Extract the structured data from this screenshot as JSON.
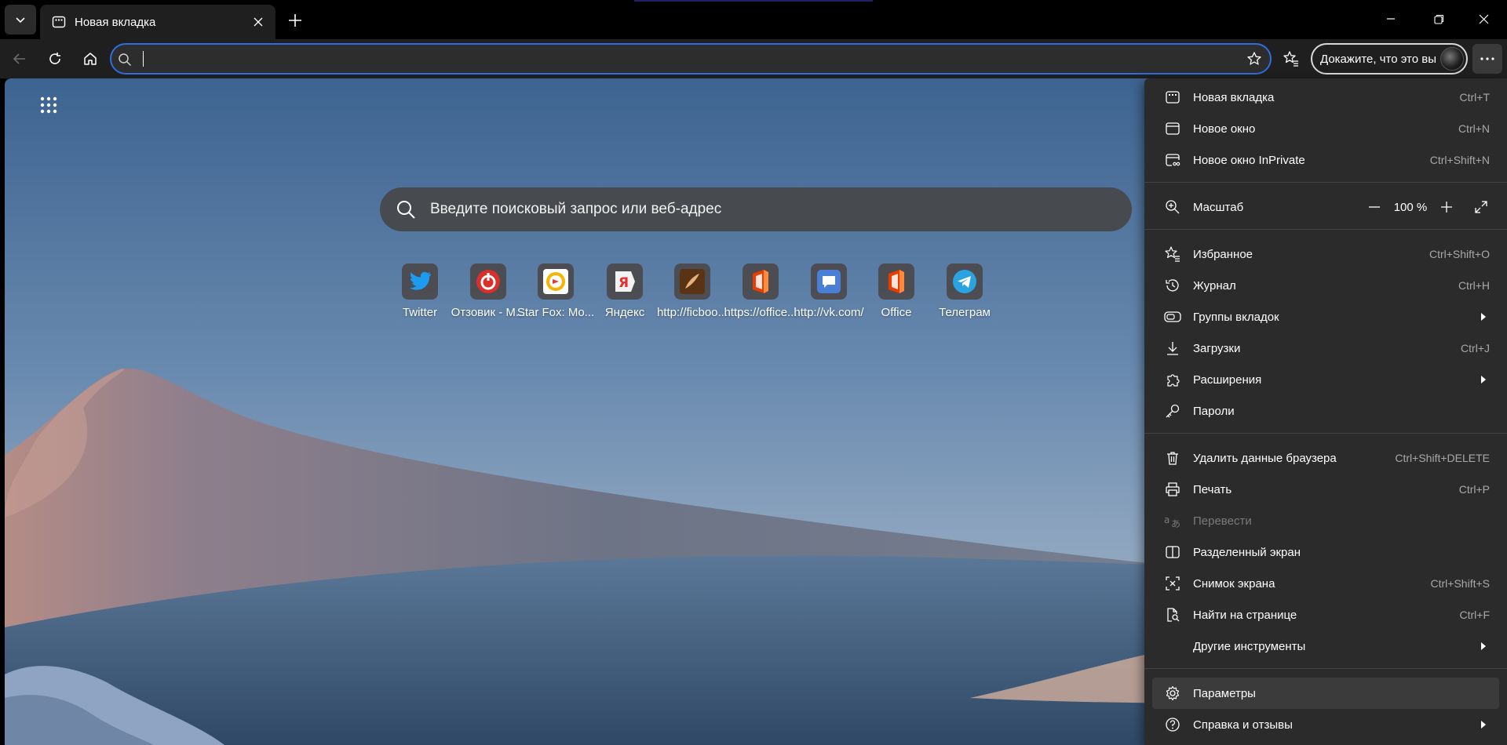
{
  "tab": {
    "title": "Новая вкладка"
  },
  "address": {
    "value": ""
  },
  "profile": {
    "label": "Докажите, что это вы"
  },
  "ntp": {
    "search_placeholder": "Введите поисковый запрос или веб-адрес",
    "tiles": [
      {
        "label": "Twitter",
        "icon": "twitter-icon"
      },
      {
        "label": "Отзовик - М...",
        "icon": "otzovik-icon"
      },
      {
        "label": "Star Fox: Mo...",
        "icon": "starfox-icon"
      },
      {
        "label": "Яндекс",
        "icon": "yandex-icon"
      },
      {
        "label": "http://ficboo...",
        "icon": "ficbook-icon"
      },
      {
        "label": "https://office...",
        "icon": "office-icon"
      },
      {
        "label": "http://vk.com/",
        "icon": "chat-bubble-icon"
      },
      {
        "label": "Office",
        "icon": "office-icon"
      },
      {
        "label": "Телеграм",
        "icon": "telegram-icon"
      }
    ]
  },
  "menu": {
    "new_tab": {
      "label": "Новая вкладка",
      "shortcut": "Ctrl+T"
    },
    "new_window": {
      "label": "Новое окно",
      "shortcut": "Ctrl+N"
    },
    "inprivate": {
      "label": "Новое окно InPrivate",
      "shortcut": "Ctrl+Shift+N"
    },
    "zoom": {
      "label": "Масштаб",
      "value": "100 %"
    },
    "favorites": {
      "label": "Избранное",
      "shortcut": "Ctrl+Shift+O"
    },
    "history": {
      "label": "Журнал",
      "shortcut": "Ctrl+H"
    },
    "tab_groups": {
      "label": "Группы вкладок"
    },
    "downloads": {
      "label": "Загрузки",
      "shortcut": "Ctrl+J"
    },
    "extensions": {
      "label": "Расширения"
    },
    "passwords": {
      "label": "Пароли"
    },
    "clear_data": {
      "label": "Удалить данные браузера",
      "shortcut": "Ctrl+Shift+DELETE"
    },
    "print": {
      "label": "Печать",
      "shortcut": "Ctrl+P"
    },
    "translate": {
      "label": "Перевести"
    },
    "split_screen": {
      "label": "Разделенный экран"
    },
    "screenshot": {
      "label": "Снимок экрана",
      "shortcut": "Ctrl+Shift+S"
    },
    "find": {
      "label": "Найти на странице",
      "shortcut": "Ctrl+F"
    },
    "more_tools": {
      "label": "Другие инструменты"
    },
    "settings": {
      "label": "Параметры"
    },
    "help": {
      "label": "Справка и отзывы"
    }
  },
  "colors": {
    "accent": "#2f6de1",
    "menu_bg": "#2b2b2b",
    "toolbar_bg": "#1f1f1f"
  }
}
